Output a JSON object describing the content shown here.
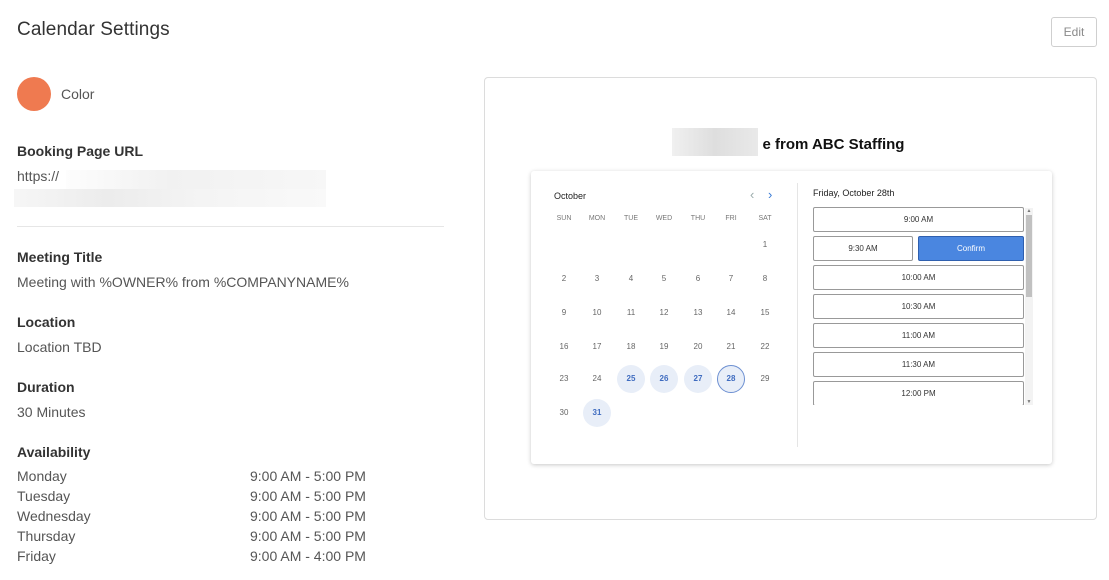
{
  "header": {
    "title": "Calendar Settings",
    "edit_label": "Edit"
  },
  "color": {
    "label": "Color",
    "swatch": "#ef7a50"
  },
  "booking": {
    "label": "Booking Page URL",
    "value_prefix": "https://"
  },
  "meeting_title": {
    "label": "Meeting Title",
    "value": "Meeting with %OWNER% from %COMPANYNAME%"
  },
  "location": {
    "label": "Location",
    "value": "Location TBD"
  },
  "duration": {
    "label": "Duration",
    "value": "30 Minutes"
  },
  "availability": {
    "label": "Availability",
    "rows": [
      {
        "day": "Monday",
        "hours": "9:00 AM - 5:00 PM"
      },
      {
        "day": "Tuesday",
        "hours": "9:00 AM - 5:00 PM"
      },
      {
        "day": "Wednesday",
        "hours": "9:00 AM - 5:00 PM"
      },
      {
        "day": "Thursday",
        "hours": "9:00 AM - 5:00 PM"
      },
      {
        "day": "Friday",
        "hours": "9:00 AM - 4:00 PM"
      }
    ]
  },
  "preview": {
    "title_suffix": "e from ABC Staffing",
    "calendar": {
      "month": "October",
      "prev_icon": "chevron-left-icon",
      "next_icon": "chevron-right-icon",
      "weekdays": [
        "SUN",
        "MON",
        "TUE",
        "WED",
        "THU",
        "FRI",
        "SAT"
      ],
      "weeks": [
        [
          "",
          "",
          "",
          "",
          "",
          "",
          "1"
        ],
        [
          "2",
          "3",
          "4",
          "5",
          "6",
          "7",
          "8"
        ],
        [
          "9",
          "10",
          "11",
          "12",
          "13",
          "14",
          "15"
        ],
        [
          "16",
          "17",
          "18",
          "19",
          "20",
          "21",
          "22"
        ],
        [
          "23",
          "24",
          "25",
          "26",
          "27",
          "28",
          "29"
        ],
        [
          "30",
          "31",
          "",
          "",
          "",
          "",
          ""
        ]
      ],
      "available_days": [
        "25",
        "26",
        "27",
        "28",
        "31"
      ],
      "selected_day": "28"
    },
    "slots": {
      "date_label": "Friday, October 28th",
      "confirm_label": "Confirm",
      "times": [
        "9:00 AM",
        "9:30 AM",
        "10:00 AM",
        "10:30 AM",
        "11:00 AM",
        "11:30 AM",
        "12:00 PM"
      ],
      "selected_time": "9:30 AM"
    }
  }
}
